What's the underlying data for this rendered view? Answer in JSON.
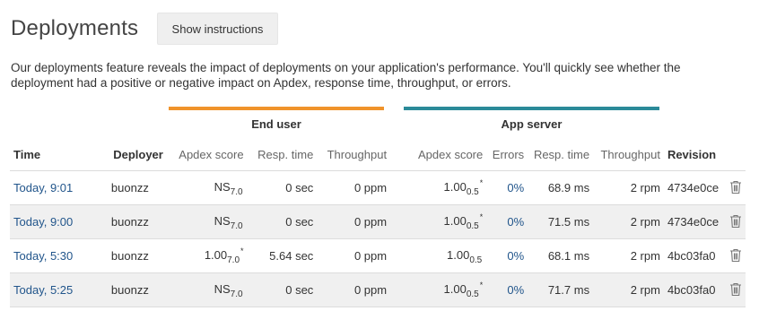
{
  "title": "Deployments",
  "show_instructions_label": "Show instructions",
  "description": "Our deployments feature reveals the impact of deployments on your application's performance. You'll quickly see whether the deployment had a positive or negative impact on Apdex, response time, throughput, or errors.",
  "groups": {
    "end_user": {
      "label": "End user",
      "color": "#f0932b"
    },
    "app_server": {
      "label": "App server",
      "color": "#2b8a99"
    }
  },
  "columns": {
    "time": "Time",
    "deployer": "Deployer",
    "eu_apdex": "Apdex score",
    "eu_resp": "Resp. time",
    "eu_throughput": "Throughput",
    "as_apdex": "Apdex score",
    "as_errors": "Errors",
    "as_resp": "Resp. time",
    "as_throughput": "Throughput",
    "revision": "Revision"
  },
  "rows": [
    {
      "time": "Today, 9:01",
      "deployer": "buonzz",
      "eu_apdex": "NS",
      "eu_apdex_sub": "7.0",
      "eu_apdex_star": "",
      "eu_resp": "0 sec",
      "eu_throughput": "0 ppm",
      "as_apdex": "1.00",
      "as_apdex_sub": "0.5",
      "as_apdex_star": "*",
      "as_errors": "0%",
      "as_resp": "68.9 ms",
      "as_throughput": "2 rpm",
      "revision": "4734e0ce"
    },
    {
      "time": "Today, 9:00",
      "deployer": "buonzz",
      "eu_apdex": "NS",
      "eu_apdex_sub": "7.0",
      "eu_apdex_star": "",
      "eu_resp": "0 sec",
      "eu_throughput": "0 ppm",
      "as_apdex": "1.00",
      "as_apdex_sub": "0.5",
      "as_apdex_star": "*",
      "as_errors": "0%",
      "as_resp": "71.5 ms",
      "as_throughput": "2 rpm",
      "revision": "4734e0ce"
    },
    {
      "time": "Today, 5:30",
      "deployer": "buonzz",
      "eu_apdex": "1.00",
      "eu_apdex_sub": "7.0",
      "eu_apdex_star": "*",
      "eu_resp": "5.64 sec",
      "eu_throughput": "0 ppm",
      "as_apdex": "1.00",
      "as_apdex_sub": "0.5",
      "as_apdex_star": "",
      "as_errors": "0%",
      "as_resp": "68.1 ms",
      "as_throughput": "2 rpm",
      "revision": "4bc03fa0"
    },
    {
      "time": "Today, 5:25",
      "deployer": "buonzz",
      "eu_apdex": "NS",
      "eu_apdex_sub": "7.0",
      "eu_apdex_star": "",
      "eu_resp": "0 sec",
      "eu_throughput": "0 ppm",
      "as_apdex": "1.00",
      "as_apdex_sub": "0.5",
      "as_apdex_star": "*",
      "as_errors": "0%",
      "as_resp": "71.7 ms",
      "as_throughput": "2 rpm",
      "revision": "4bc03fa0"
    }
  ],
  "icons": {
    "delete": "trash-icon"
  },
  "colors": {
    "link": "#21558b",
    "row_alt": "#f0f0f0"
  }
}
